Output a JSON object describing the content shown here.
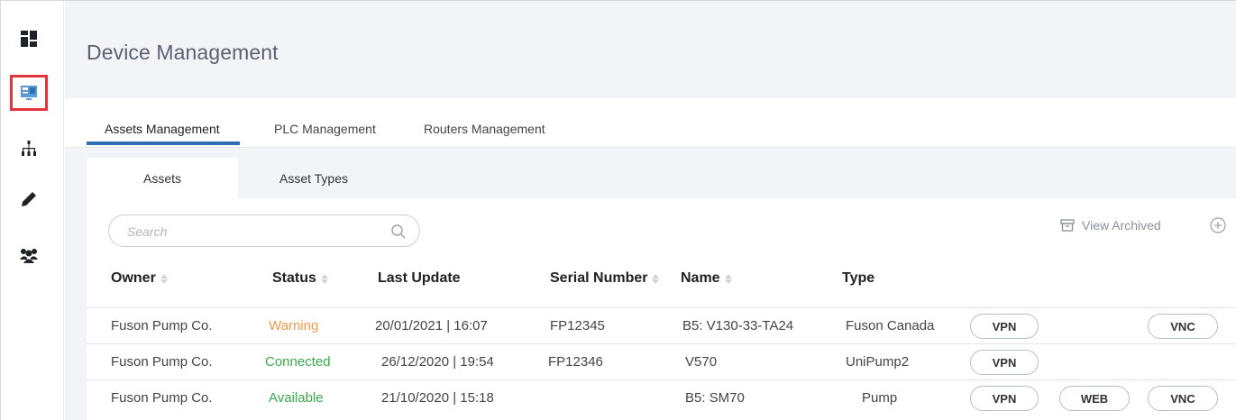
{
  "sidebar": {
    "items": [
      {
        "icon": "dashboard-icon"
      },
      {
        "icon": "device-management-icon",
        "active": true
      },
      {
        "icon": "hierarchy-icon"
      },
      {
        "icon": "pencil-icon"
      },
      {
        "icon": "users-icon"
      }
    ]
  },
  "header": {
    "title": "Device Management"
  },
  "top_tabs": [
    {
      "label": "Assets Management",
      "active": true
    },
    {
      "label": "PLC Management"
    },
    {
      "label": "Routers Management"
    }
  ],
  "sub_tabs": [
    {
      "label": "Assets",
      "active": true
    },
    {
      "label": "Asset Types"
    }
  ],
  "search": {
    "placeholder": "Search",
    "value": ""
  },
  "toolbar": {
    "view_archived_label": "View Archived"
  },
  "table": {
    "headers": {
      "owner": "Owner",
      "status": "Status",
      "last_update": "Last Update",
      "serial_number": "Serial Number",
      "name": "Name",
      "type": "Type"
    },
    "rows": [
      {
        "owner": "Fuson Pump Co.",
        "status": "Warning",
        "last_update": "20/01/2021 | 16:07",
        "serial_number": "FP12345",
        "name": "B5: V130-33-TA24",
        "type": "Fuson Canada",
        "vpn": "VPN",
        "web": "",
        "vnc": "VNC"
      },
      {
        "owner": "Fuson Pump Co.",
        "status": "Connected",
        "last_update": "26/12/2020 | 19:54",
        "serial_number": "FP12346",
        "name": "V570",
        "type": "UniPump2",
        "vpn": "VPN",
        "web": "",
        "vnc": ""
      },
      {
        "owner": "Fuson Pump Co.",
        "status": "Available",
        "last_update": "21/10/2020 | 15:18",
        "serial_number": "",
        "name": "B5: SM70",
        "type": "Pump",
        "vpn": "VPN",
        "web": "WEB",
        "vnc": "VNC"
      }
    ]
  },
  "colors": {
    "accent": "#2f6db5",
    "highlight_box": "#e0353b",
    "status_warning": "#f19a4a",
    "status_ok": "#3aa84a",
    "header_bg": "#f3f4f8"
  }
}
